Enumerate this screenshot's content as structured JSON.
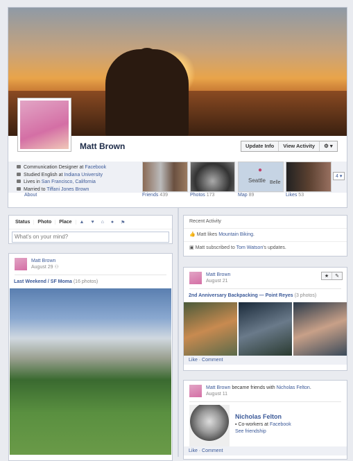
{
  "profile": {
    "name": "Matt Brown",
    "buttons": [
      "Update Info",
      "View Activity"
    ],
    "gear": "gear-icon",
    "info": [
      {
        "pre": "Communication Designer at ",
        "link": "Facebook"
      },
      {
        "pre": "Studied English at ",
        "link": "Indiana University"
      },
      {
        "pre": "Lives in ",
        "link": "San Francisco, California"
      },
      {
        "pre": "Married to ",
        "link": "Tiffani Jones Brown"
      }
    ],
    "about": "About",
    "tiles": [
      {
        "label": "Friends",
        "count": "439"
      },
      {
        "label": "Photos",
        "count": "173"
      },
      {
        "label": "Map",
        "count": "89"
      },
      {
        "label": "Likes",
        "count": "53"
      }
    ],
    "more": "4 ▾",
    "map_labels": [
      "Seattle",
      "Belle"
    ]
  },
  "composer": {
    "tabs": [
      "Status",
      "Photo",
      "Place"
    ],
    "placeholder": "What's on your mind?"
  },
  "recent": {
    "title": "Recent Activity",
    "items": [
      {
        "pre": "Matt likes ",
        "link": "Mountain Biking",
        "post": "."
      },
      {
        "pre": "Matt subscribed to ",
        "link": "Tom Watson",
        "post": "'s updates."
      }
    ]
  },
  "post1": {
    "author": "Matt Brown",
    "date": "August 29",
    "album": "Last Weekend / SF Moma",
    "count": "(16 photos)"
  },
  "post2": {
    "author": "Matt Brown",
    "date": "August 21",
    "album": "2nd Anniversary Backpacking — Point Reyes",
    "count": "(3 photos)",
    "actions": "Like · Comment"
  },
  "post3": {
    "author": "Matt Brown",
    "verb": " became friends with ",
    "friend": "Nicholas Felton",
    "date": "August 11",
    "friend_name": "Nicholas Felton",
    "relation_pre": "Co-workers at ",
    "relation_link": "Facebook",
    "see": "See friendship",
    "actions": "Like · Comment"
  }
}
